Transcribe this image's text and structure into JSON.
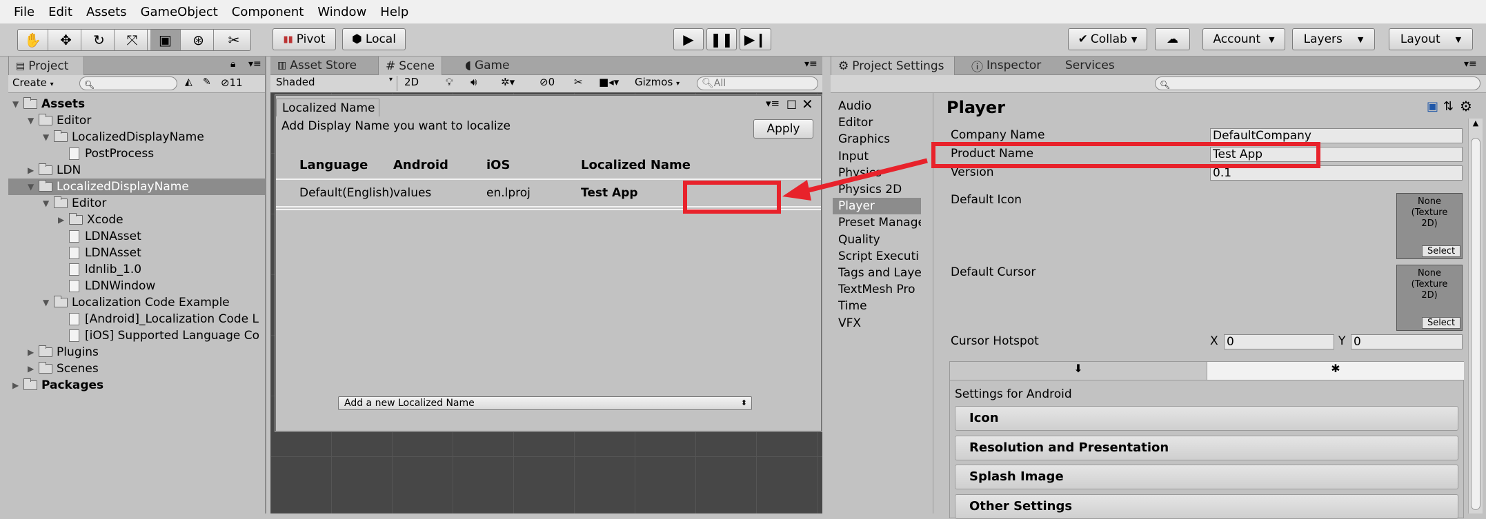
{
  "menu": [
    "File",
    "Edit",
    "Assets",
    "GameObject",
    "Component",
    "Window",
    "Help"
  ],
  "toolbar": {
    "pivot": "Pivot",
    "local": "Local",
    "collab": "Collab",
    "account": "Account",
    "layers": "Layers",
    "layout": "Layout"
  },
  "project": {
    "tab": "Project",
    "create": "Create",
    "count": "11",
    "items": [
      {
        "label": "Assets",
        "level": 0,
        "arrow": "▼",
        "type": "folder",
        "bold": true
      },
      {
        "label": "Editor",
        "level": 1,
        "arrow": "▼",
        "type": "folder"
      },
      {
        "label": "LocalizedDisplayName",
        "level": 2,
        "arrow": "▼",
        "type": "folder"
      },
      {
        "label": "PostProcess",
        "level": 3,
        "arrow": "",
        "type": "file"
      },
      {
        "label": "LDN",
        "level": 1,
        "arrow": "▶",
        "type": "folder"
      },
      {
        "label": "LocalizedDisplayName",
        "level": 1,
        "arrow": "▼",
        "type": "folder",
        "selected": true
      },
      {
        "label": "Editor",
        "level": 2,
        "arrow": "▼",
        "type": "folder"
      },
      {
        "label": "Xcode",
        "level": 3,
        "arrow": "▶",
        "type": "folder"
      },
      {
        "label": "LDNAsset",
        "level": 3,
        "arrow": "",
        "type": "file"
      },
      {
        "label": "LDNAsset",
        "level": 3,
        "arrow": "",
        "type": "file"
      },
      {
        "label": "ldnlib_1.0",
        "level": 3,
        "arrow": "",
        "type": "file"
      },
      {
        "label": "LDNWindow",
        "level": 3,
        "arrow": "",
        "type": "file"
      },
      {
        "label": "Localization Code Example",
        "level": 2,
        "arrow": "▼",
        "type": "folder"
      },
      {
        "label": "[Android]_Localization Code L",
        "level": 3,
        "arrow": "",
        "type": "file"
      },
      {
        "label": "[iOS] Supported Language Co",
        "level": 3,
        "arrow": "",
        "type": "file"
      },
      {
        "label": "Plugins",
        "level": 1,
        "arrow": "▶",
        "type": "folder"
      },
      {
        "label": "Scenes",
        "level": 1,
        "arrow": "▶",
        "type": "folder"
      },
      {
        "label": "Packages",
        "level": 0,
        "arrow": "▶",
        "type": "folder",
        "bold": true
      }
    ]
  },
  "scene": {
    "tabs": [
      "Asset Store",
      "Scene",
      "Game"
    ],
    "shaded": "Shaded",
    "mode2d": "2D",
    "hidden": "0",
    "gizmos": "Gizmos",
    "search_placeholder": "All"
  },
  "dialog": {
    "title": "Localized Name",
    "subtitle": "Add Display Name you want to localize",
    "apply": "Apply",
    "columns": [
      "Language",
      "Android",
      "iOS",
      "Localized Name"
    ],
    "rows": [
      [
        "Default(English)",
        "values",
        "en.lproj",
        "Test App"
      ]
    ],
    "add_dropdown": "Add a new Localized Name"
  },
  "settings": {
    "tabs": [
      "Project Settings",
      "Inspector",
      "Services"
    ],
    "categories": [
      "Audio",
      "Editor",
      "Graphics",
      "Input",
      "Physics",
      "Physics 2D",
      "Player",
      "Preset Manage",
      "Quality",
      "Script Executi",
      "Tags and Laye",
      "TextMesh Pro",
      "Time",
      "VFX"
    ],
    "selected_category": "Player",
    "title": "Player",
    "company_label": "Company Name",
    "company": "DefaultCompany",
    "product_label": "Product Name",
    "product": "Test App",
    "version_label": "Version",
    "version": "0.1",
    "default_icon": "Default Icon",
    "default_cursor": "Default Cursor",
    "none_texture": "None\n(Texture\n2D)",
    "select": "Select",
    "cursor_hotspot": "Cursor Hotspot",
    "x_label": "X",
    "x": "0",
    "y_label": "Y",
    "y": "0",
    "android_settings": "Settings for Android",
    "sections": [
      "Icon",
      "Resolution and Presentation",
      "Splash Image",
      "Other Settings"
    ]
  },
  "colors": {
    "highlight": "#e8222b",
    "selection": "#8c8c8c"
  }
}
